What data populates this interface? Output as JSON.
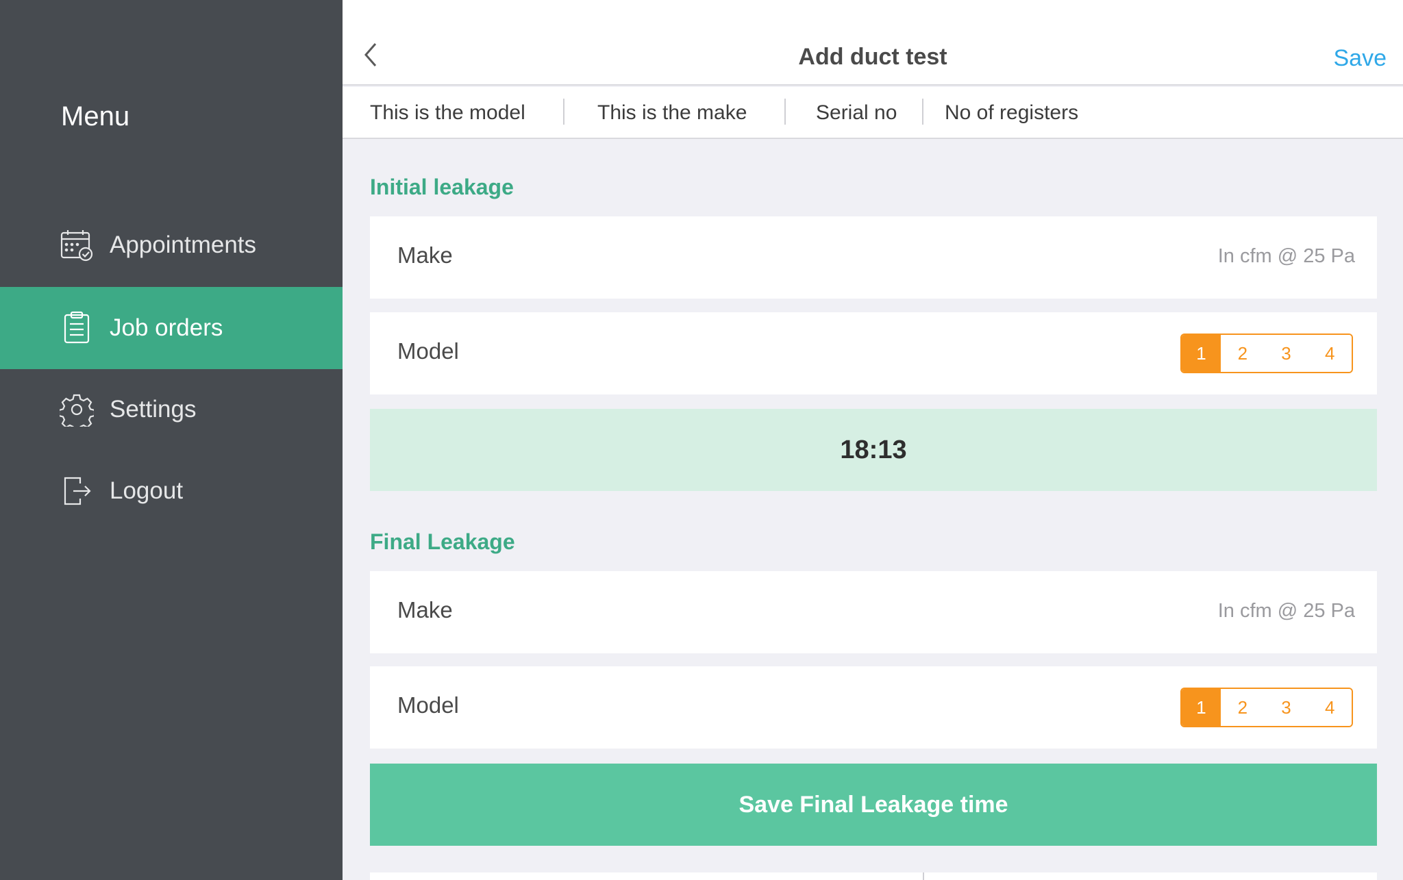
{
  "sidebar": {
    "title": "Menu",
    "items": [
      {
        "label": "Appointments",
        "icon": "calendar-check-icon",
        "active": false
      },
      {
        "label": "Job orders",
        "icon": "clipboard-icon",
        "active": true
      },
      {
        "label": "Settings",
        "icon": "gear-icon",
        "active": false
      },
      {
        "label": "Logout",
        "icon": "logout-icon",
        "active": false
      }
    ]
  },
  "header": {
    "title": "Add duct test",
    "save_label": "Save",
    "back_icon": "chevron-left-icon"
  },
  "info": {
    "model": "This is the model",
    "make": "This is  the make",
    "serial": "Serial no",
    "registers": "No of registers"
  },
  "initial": {
    "title": "Initial leakage",
    "make_label": "Make",
    "make_hint": "In cfm @ 25 Pa",
    "model_label": "Model",
    "segments": [
      "1",
      "2",
      "3",
      "4"
    ],
    "selected": "1",
    "timer": "18:13"
  },
  "final": {
    "title": "Final Leakage",
    "make_label": "Make",
    "make_hint": "In cfm @ 25 Pa",
    "model_label": "Model",
    "segments": [
      "1",
      "2",
      "3",
      "4"
    ],
    "selected": "1",
    "save_button": "Save Final Leakage time"
  },
  "colors": {
    "sidebar_bg": "#474b50",
    "accent_green": "#3daa86",
    "button_green": "#5bc6a0",
    "timer_bg": "#d6efe3",
    "orange": "#f7941d",
    "link_blue": "#2fa8e8"
  }
}
